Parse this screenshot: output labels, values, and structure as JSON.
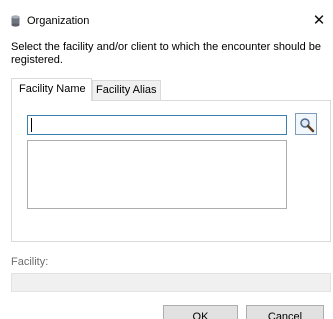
{
  "window": {
    "title": "Organization",
    "icon": "database-icon",
    "close_label": "✕"
  },
  "instruction": "Select the facility and/or client to which the encounter should be registered.",
  "tabs": [
    {
      "label": "Facility Name",
      "active": true
    },
    {
      "label": "Facility Alias",
      "active": false
    }
  ],
  "search": {
    "value": "",
    "placeholder": "",
    "button_icon": "magnifier-icon"
  },
  "results": {
    "items": []
  },
  "facility": {
    "label": "Facility:",
    "value": ""
  },
  "buttons": {
    "ok_label": "OK",
    "cancel_label": "Cancel"
  },
  "colors": {
    "accent_border": "#3c7fb1",
    "button_face": "#e1e1e1",
    "disabled_field": "#f0f0f0"
  }
}
